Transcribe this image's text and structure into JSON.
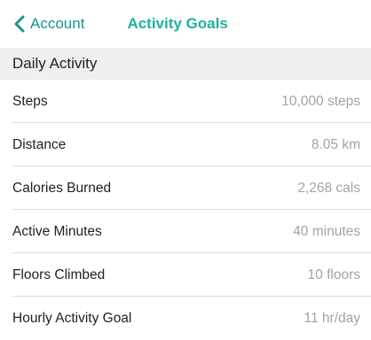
{
  "nav": {
    "back_label": "Account",
    "title": "Activity Goals"
  },
  "section": {
    "title": "Daily Activity"
  },
  "goals": [
    {
      "label": "Steps",
      "value": "10,000 steps"
    },
    {
      "label": "Distance",
      "value": "8.05 km"
    },
    {
      "label": "Calories Burned",
      "value": "2,268 cals"
    },
    {
      "label": "Active Minutes",
      "value": "40 minutes"
    },
    {
      "label": "Floors Climbed",
      "value": "10 floors"
    },
    {
      "label": "Hourly Activity Goal",
      "value": "11 hr/day"
    }
  ],
  "colors": {
    "accent": "#1fb0a2",
    "back": "#14968f",
    "section_bg": "#efefef",
    "value_text": "#a3a3a3",
    "divider": "#dcdcdc"
  },
  "icons": {
    "back": "chevron-left-icon"
  }
}
